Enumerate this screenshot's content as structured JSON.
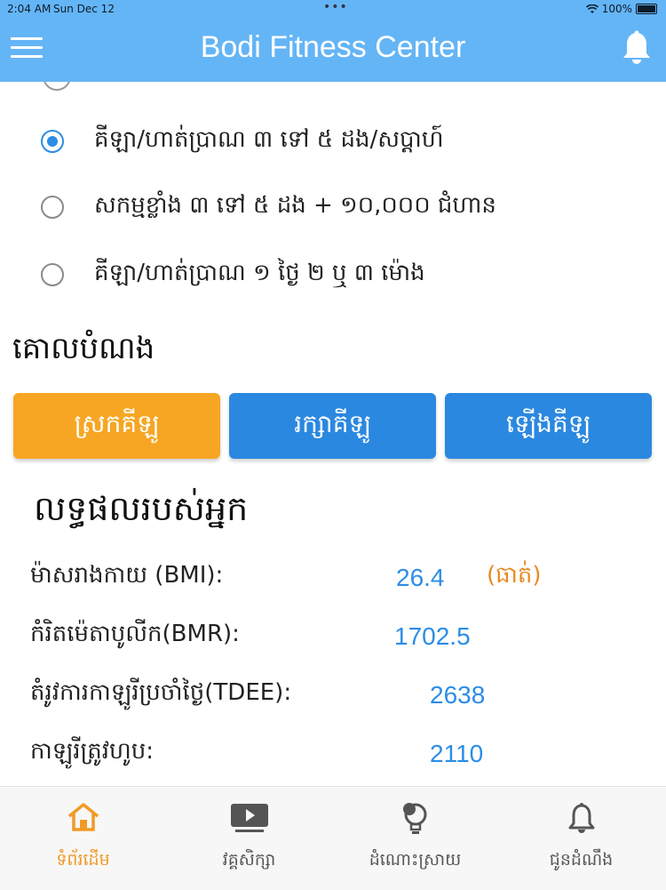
{
  "status": {
    "time": "2:04 AM",
    "date": "Sun Dec 12",
    "battery": "100%"
  },
  "header": {
    "title": "Bodi Fitness Center"
  },
  "activity_options": [
    {
      "label": "គីឡា/ហាត់ប្រាណ ៣ ទៅ ៥ ដង/សប្តាហ៍",
      "selected": true
    },
    {
      "label": "សកម្មខ្លាំង ៣ ទៅ ៥ ដង + ១០,០០០ ជំហាន",
      "selected": false
    },
    {
      "label": "គីឡា/ហាត់ប្រាណ ១ ថ្ងៃ ២ ឬ ៣ ម៉ោង",
      "selected": false
    }
  ],
  "goal": {
    "title": "គោលបំណង",
    "buttons": [
      "ស្រកគីឡូ",
      "រក្សាគីឡូ",
      "ឡើងគីឡូ"
    ],
    "active_index": 0
  },
  "results": {
    "title": "លទ្ធផលរបស់អ្នក",
    "rows": [
      {
        "label": "ម៉ាសរាងកាយ (BMI):",
        "value": "26.4",
        "tag": "(ធាត់)"
      },
      {
        "label": "កំរិតម៉េតាបូលីក(BMR):",
        "value": "1702.5"
      },
      {
        "label": "តំរូវការកាឡូរីប្រចាំថ្ងៃ(TDEE):",
        "value": "2638"
      },
      {
        "label": "កាឡូរីត្រូវហូប:",
        "value": "2110"
      }
    ]
  },
  "tabs": [
    {
      "label": "ទំព័រដើម",
      "icon": "home-icon",
      "active": true
    },
    {
      "label": "វគ្គសិក្សា",
      "icon": "video-icon",
      "active": false
    },
    {
      "label": "ដំណោះស្រាយ",
      "icon": "lightbulb-icon",
      "active": false
    },
    {
      "label": "ជូនដំណឹង",
      "icon": "bell-icon",
      "active": false
    }
  ],
  "colors": {
    "header": "#64b5f6",
    "accent_blue": "#2b88e0",
    "accent_orange": "#f6a623"
  }
}
